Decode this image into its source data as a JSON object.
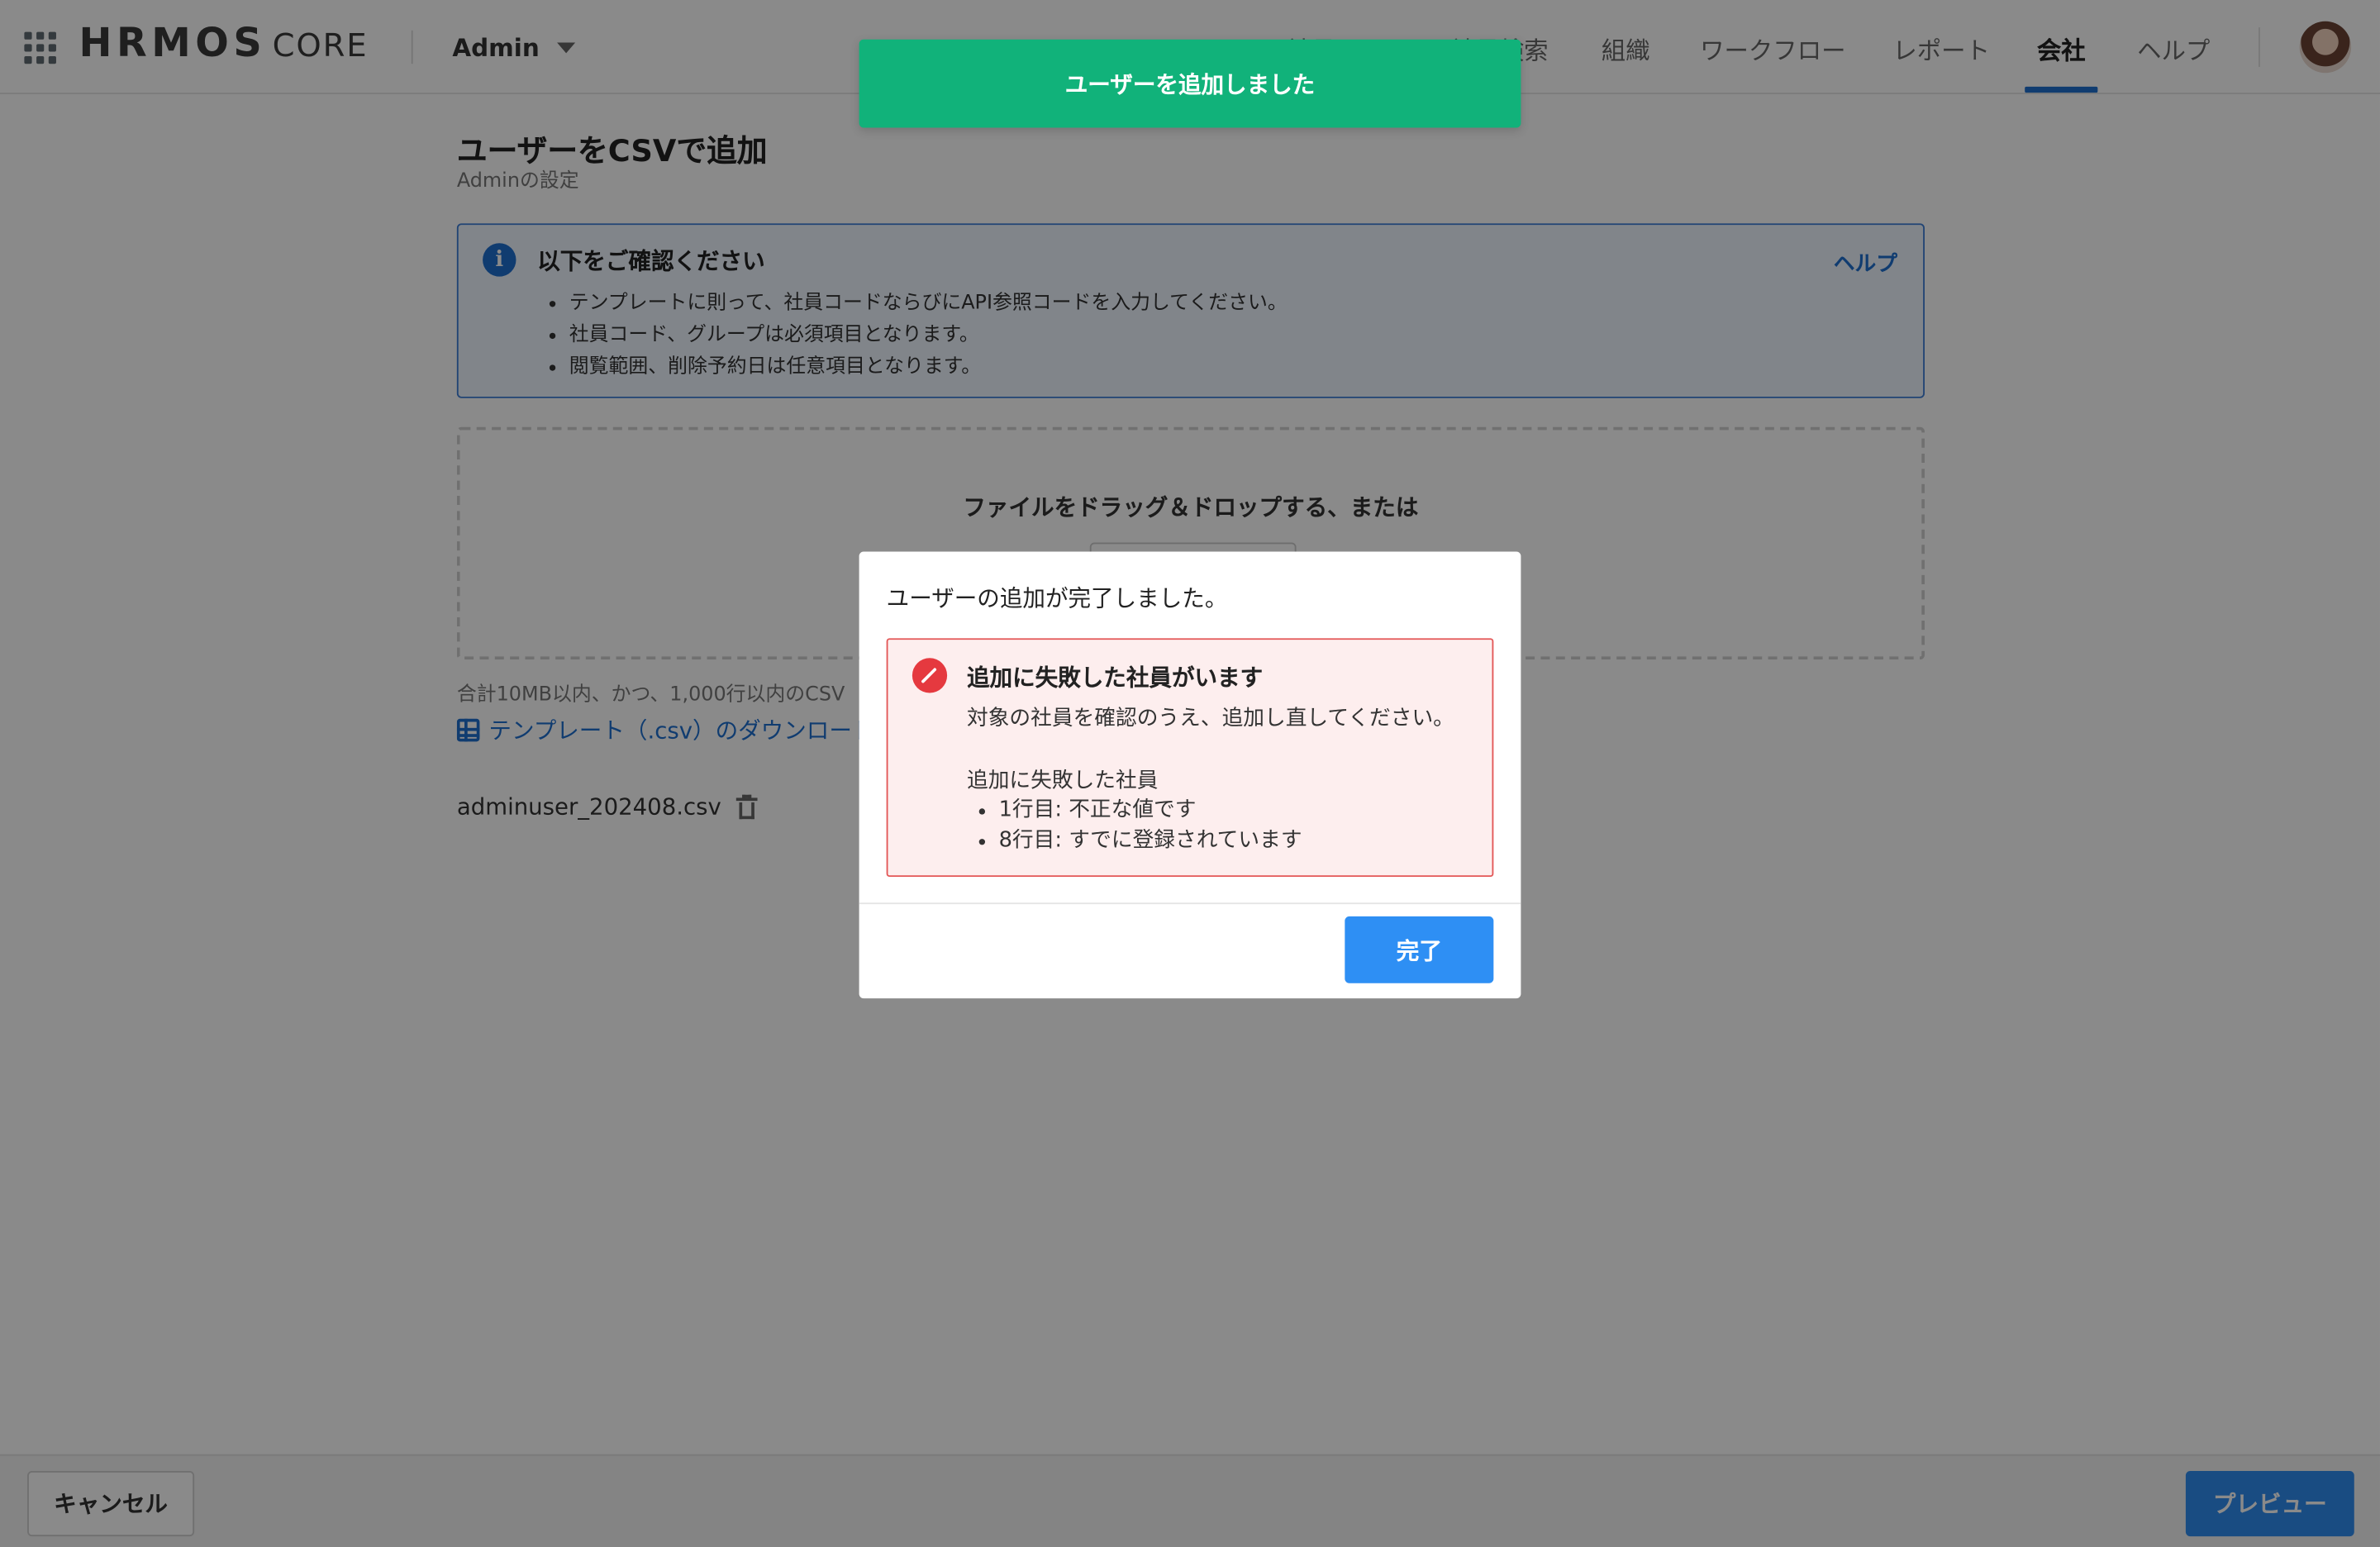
{
  "header": {
    "logo_brand": "HRMOS",
    "logo_sub": "CORE",
    "tenant": "Admin",
    "nav": [
      {
        "label": "社員"
      },
      {
        "label": "社員検索"
      },
      {
        "label": "組織"
      },
      {
        "label": "ワークフロー"
      },
      {
        "label": "レポート"
      },
      {
        "label": "会社",
        "active": true
      },
      {
        "label": "ヘルプ"
      }
    ]
  },
  "page": {
    "title": "ユーザーをCSVで追加",
    "subtitle": "Adminの設定"
  },
  "info": {
    "title": "以下をご確認ください",
    "help": "ヘルプ",
    "items": [
      "テンプレートに則って、社員コードならびにAPI参照コードを入力してください。",
      "社員コード、グループは必須項目となります。",
      "閲覧範囲、削除予約日は任意項目となります。"
    ]
  },
  "dropzone": {
    "text": "ファイルをドラッグ＆ドロップする、または"
  },
  "limit_text": "合計10MB以内、かつ、1,000行以内のCSV",
  "template_link": "テンプレート（.csv）のダウンロード",
  "file": {
    "name": "adminuser_202408.csv"
  },
  "footer": {
    "cancel": "キャンセル",
    "preview": "プレビュー"
  },
  "toast": {
    "message": "ユーザーを追加しました",
    "color": "#11b27a"
  },
  "modal": {
    "message": "ユーザーの追加が完了しました。",
    "alert": {
      "title": "追加に失敗した社員がいます",
      "description": "対象の社員を確認のうえ、追加し直してください。",
      "failed_title": "追加に失敗した社員",
      "failed_items": [
        "1行目: 不正な値です",
        "8行目: すでに登録されています"
      ]
    },
    "done": "完了"
  },
  "colors": {
    "accent": "#1f6fd0",
    "primary_button": "#2e8ff4",
    "error": "#e5393f",
    "success": "#11b27a"
  }
}
